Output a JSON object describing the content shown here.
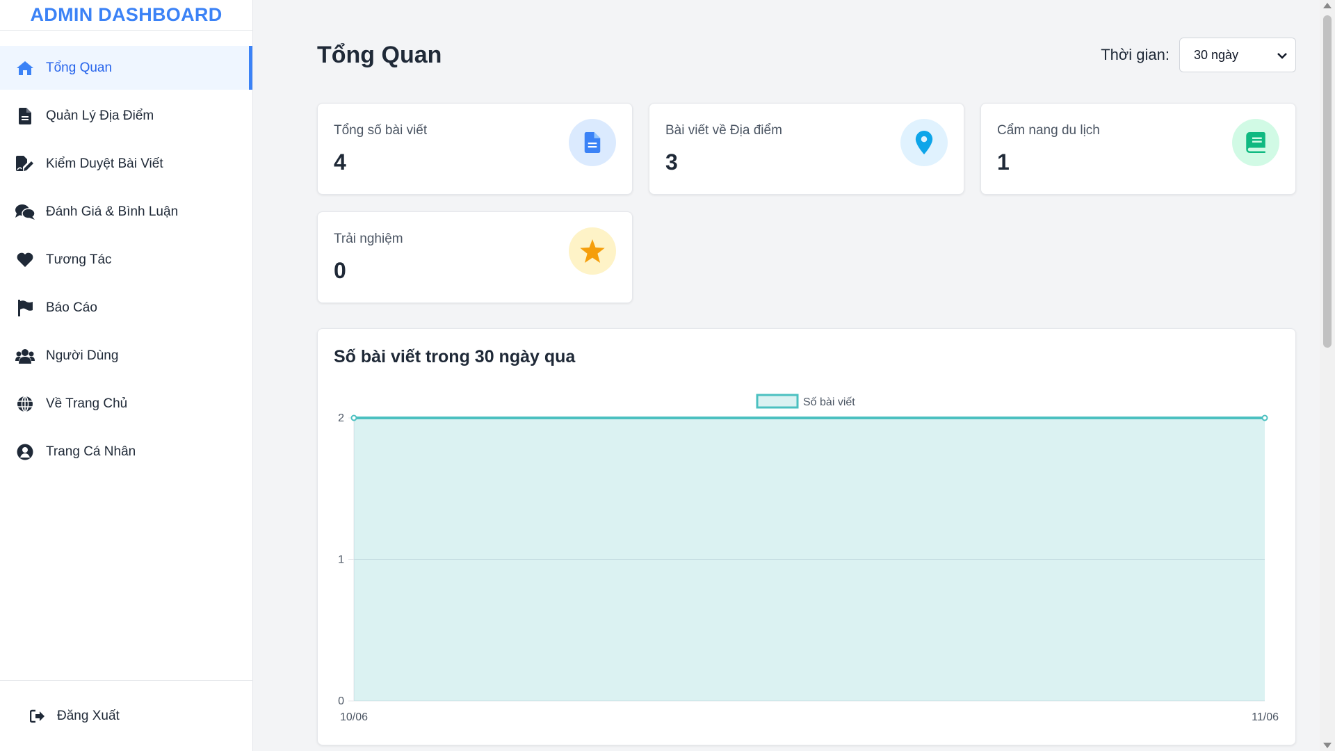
{
  "brand": {
    "title": "ADMIN DASHBOARD"
  },
  "sidebar": {
    "items": [
      {
        "label": "Tổng Quan",
        "icon": "home-icon",
        "active": true
      },
      {
        "label": "Quản Lý Địa Điểm",
        "icon": "document-icon"
      },
      {
        "label": "Kiểm Duyệt Bài Viết",
        "icon": "signature-icon"
      },
      {
        "label": "Đánh Giá & Bình Luận",
        "icon": "comments-icon"
      },
      {
        "label": "Tương Tác",
        "icon": "heart-icon"
      },
      {
        "label": "Báo Cáo",
        "icon": "flag-icon"
      },
      {
        "label": "Người Dùng",
        "icon": "users-icon"
      },
      {
        "label": "Về Trang Chủ",
        "icon": "globe-icon"
      },
      {
        "label": "Trang Cá Nhân",
        "icon": "user-circle-icon"
      }
    ],
    "logout": {
      "label": "Đăng Xuất",
      "icon": "sign-out-icon"
    }
  },
  "header": {
    "title": "Tổng Quan",
    "period_label": "Thời gian:",
    "period_value": "30 ngày"
  },
  "stats": [
    {
      "label": "Tổng số bài viết",
      "value": "4",
      "icon": "document-icon",
      "color": "#3b82f6",
      "bg": "#dbeafe"
    },
    {
      "label": "Bài viết về Địa điểm",
      "value": "3",
      "icon": "map-pin-icon",
      "color": "#0ea5e9",
      "bg": "#e0f2fe"
    },
    {
      "label": "Cẩm nang du lịch",
      "value": "1",
      "icon": "book-icon",
      "color": "#10b981",
      "bg": "#d1fae5"
    },
    {
      "label": "Trải nghiệm",
      "value": "0",
      "icon": "star-icon",
      "color": "#f59e0b",
      "bg": "#fef3c7"
    }
  ],
  "chart": {
    "title": "Số bài viết trong 30 ngày qua"
  },
  "chart_data": {
    "type": "area",
    "categories": [
      "10/06",
      "11/06"
    ],
    "series": [
      {
        "name": "Số bài viết",
        "values": [
          2,
          2
        ],
        "color": "#4bc0c0"
      }
    ],
    "ylim": [
      0,
      2
    ],
    "yticks": [
      "0",
      "1",
      "2"
    ],
    "legend": "top",
    "grid": true
  }
}
